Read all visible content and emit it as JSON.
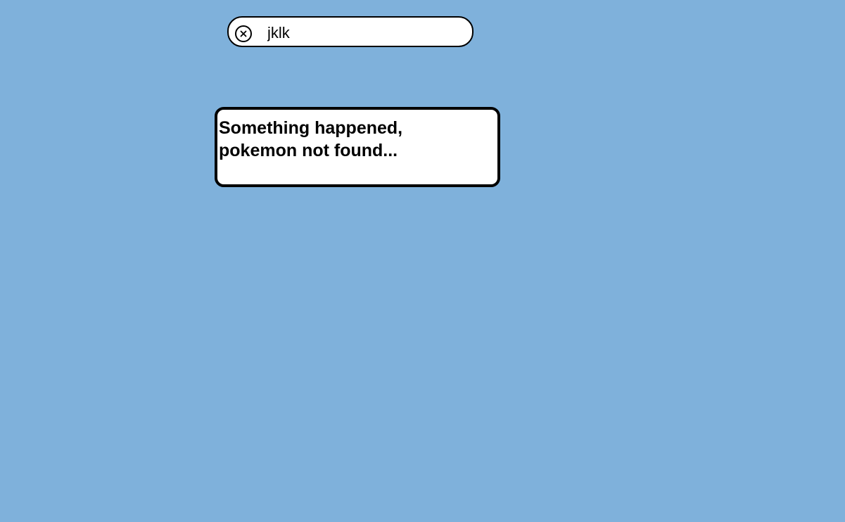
{
  "search": {
    "value": "jklk",
    "clear_icon": "close-circle-icon"
  },
  "error": {
    "message": "Something happened, pokemon not found..."
  },
  "colors": {
    "background": "#7fb1db",
    "card": "#ffffff",
    "border": "#000000"
  }
}
